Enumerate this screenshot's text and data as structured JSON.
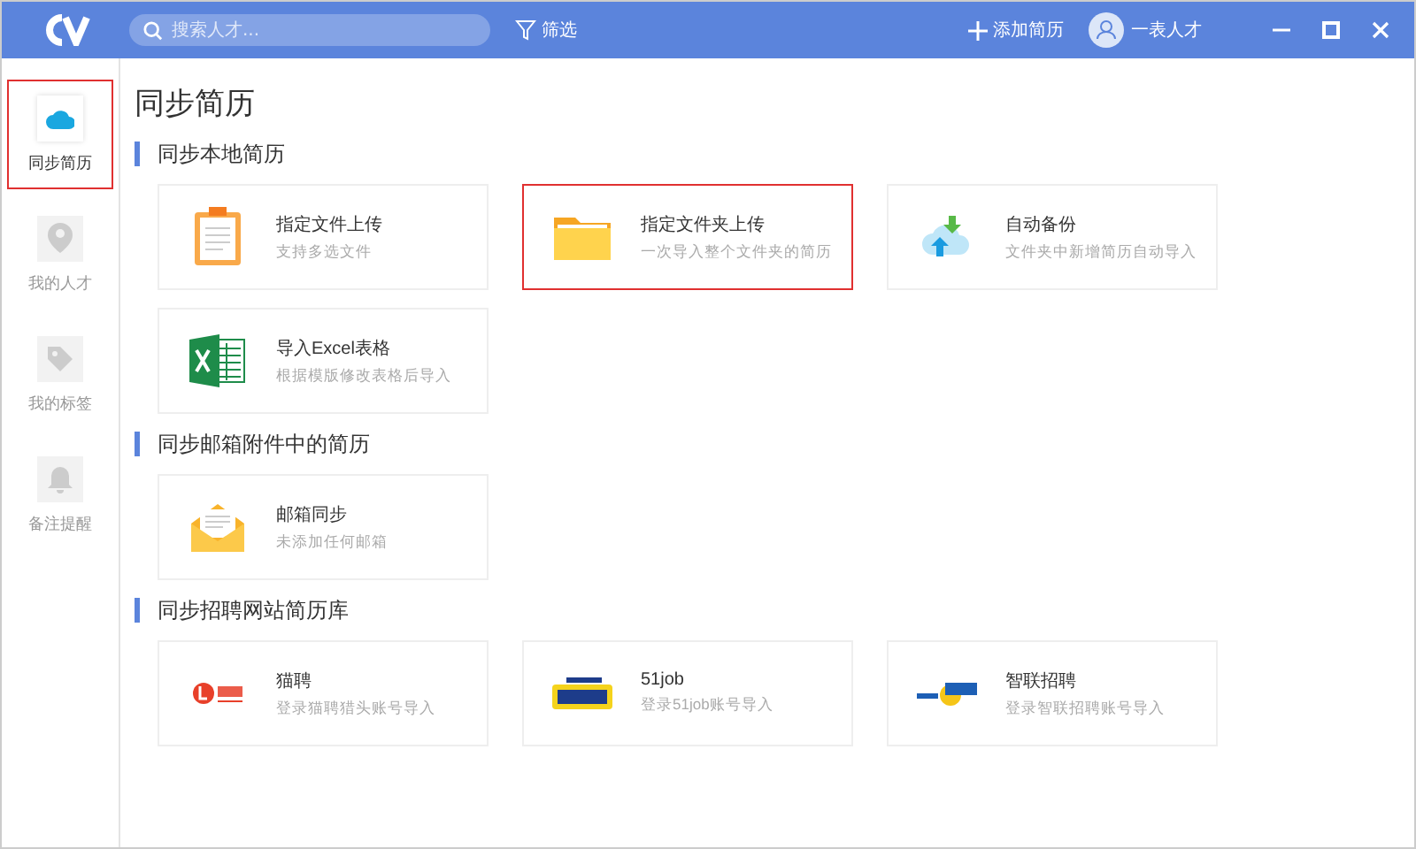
{
  "header": {
    "search": {
      "placeholder": "搜索人才..."
    },
    "filter_label": "筛选",
    "add_label": "添加简历",
    "user_name": "一表人才"
  },
  "sidebar": {
    "items": [
      {
        "label": "同步简历",
        "kind": "cloud",
        "selected": true
      },
      {
        "label": "我的人才",
        "kind": "person",
        "selected": false
      },
      {
        "label": "我的标签",
        "kind": "tag",
        "selected": false
      },
      {
        "label": "备注提醒",
        "kind": "bell",
        "selected": false
      }
    ]
  },
  "page_title": "同步简历",
  "sections": [
    {
      "title": "同步本地简历",
      "cards": [
        {
          "kind": "clipboard",
          "title": "指定文件上传",
          "subtitle": "支持多选文件",
          "selected": false
        },
        {
          "kind": "folder",
          "title": "指定文件夹上传",
          "subtitle": "一次导入整个文件夹的简历",
          "selected": true
        },
        {
          "kind": "cloud-sync",
          "title": "自动备份",
          "subtitle": "文件夹中新增简历自动导入",
          "selected": false
        },
        {
          "kind": "excel",
          "title": "导入Excel表格",
          "subtitle": "根据模版修改表格后导入",
          "selected": false
        }
      ]
    },
    {
      "title": "同步邮箱附件中的简历",
      "cards": [
        {
          "kind": "mail",
          "title": "邮箱同步",
          "subtitle": "未添加任何邮箱",
          "selected": false
        }
      ]
    },
    {
      "title": "同步招聘网站简历库",
      "cards": [
        {
          "kind": "logo-red",
          "title": "猫聘",
          "subtitle": "登录猫聘猎头账号导入",
          "selected": false
        },
        {
          "kind": "logo-yellow",
          "title": "51job",
          "subtitle": "登录51job账号导入",
          "selected": false
        },
        {
          "kind": "logo-blue",
          "title": "智联招聘",
          "subtitle": "登录智联招聘账号导入",
          "selected": false
        }
      ]
    }
  ]
}
